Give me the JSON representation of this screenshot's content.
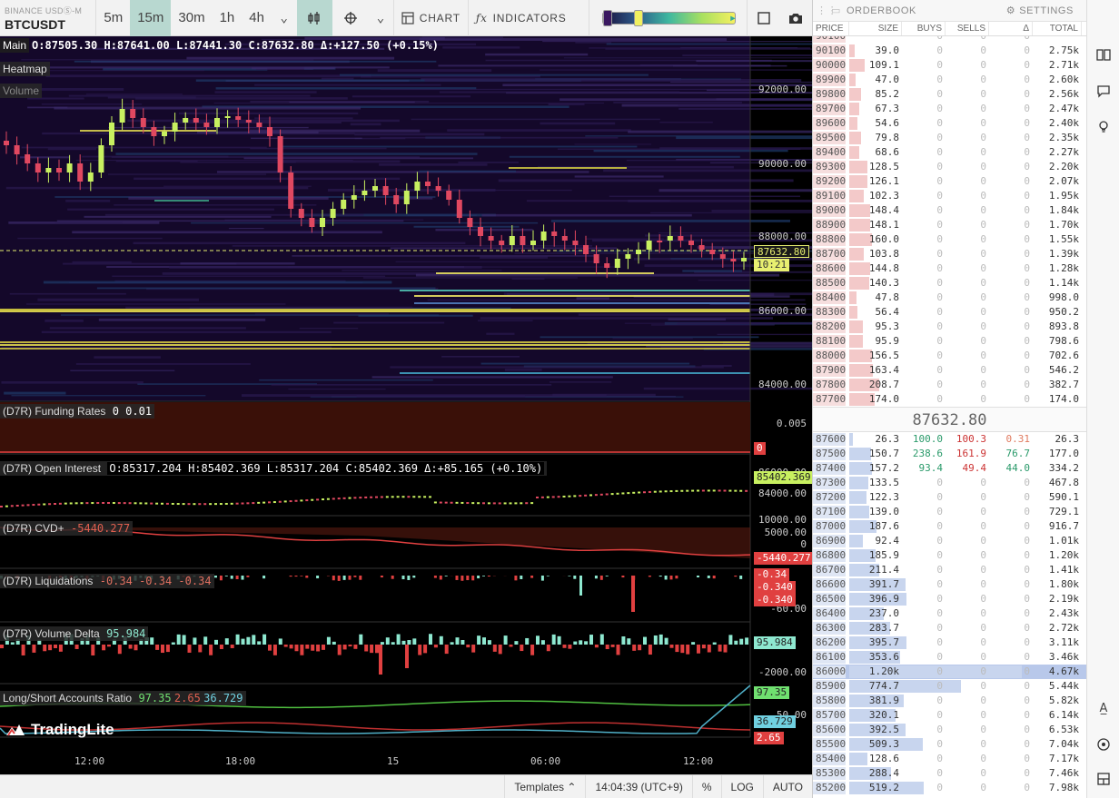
{
  "toolbar": {
    "exchange": "BINANCE USDⓈ-M",
    "symbol": "BTCUSDT",
    "timeframes": [
      "5m",
      "15m",
      "30m",
      "1h",
      "4h"
    ],
    "active_timeframe": "15m",
    "chart_label": "CHART",
    "indicators_label": "INDICATORS"
  },
  "main_pane": {
    "label": "Main",
    "ohlc": "O:87505.30 H:87641.00 L:87441.30 C:87632.80 Δ:+127.50 (+0.15%)",
    "overlays": [
      "Heatmap",
      "Volume"
    ],
    "price_axis": [
      "92000.00",
      "90000.00",
      "88000.00",
      "86000.00",
      "84000.00"
    ],
    "last_price": "87632.80",
    "countdown": "10:21"
  },
  "panes": [
    {
      "label": "(D7R) Funding Rates",
      "values": "0 0.01",
      "axis": [
        "0.005"
      ],
      "tag": "0"
    },
    {
      "label": "(D7R) Open Interest",
      "values": "O:85317.204 H:85402.369 L:85317.204 C:85402.369 Δ:+85.165 (+0.10%)",
      "axis": [
        "86000.00",
        "84000.00"
      ],
      "tag": "85402.369"
    },
    {
      "label": "(D7R) CVD+",
      "values": "-5440.277",
      "axis": [
        "10000.00",
        "5000.00",
        "0"
      ],
      "tag": "-5440.277"
    },
    {
      "label": "(D7R) Liquidations",
      "values": "-0.34 -0.34 -0.34",
      "axis": [
        "-60.00"
      ],
      "tags": [
        "-0.34",
        "-0.340",
        "-0.340"
      ]
    },
    {
      "label": "(D7R) Volume Delta",
      "values": "95.984",
      "axis": [
        "-2000.00"
      ],
      "tag": "95.984"
    },
    {
      "label": "Long/Short Accounts Ratio",
      "values": [
        "97.35",
        "2.65",
        "36.729"
      ],
      "axis": [
        "50.00"
      ],
      "tags": [
        "97.35",
        "36.729",
        "2.65"
      ]
    }
  ],
  "time_axis": [
    "12:00",
    "18:00",
    "15",
    "06:00",
    "12:00"
  ],
  "watermark": "TradingLite",
  "bottom_bar": {
    "templates": "Templates",
    "clock": "14:04:39 (UTC+9)",
    "percent": "%",
    "log": "LOG",
    "auto": "AUTO"
  },
  "orderbook": {
    "title": "ORDERBOOK",
    "settings": "SETTINGS",
    "columns": [
      "PRICE",
      "SIZE",
      "BUYS",
      "SELLS",
      "Δ",
      "TOTAL"
    ],
    "mid_price": "87632.80",
    "asks": [
      [
        "90100",
        "",
        "0",
        "0",
        "0",
        ""
      ],
      [
        "90100",
        "39.0",
        "0",
        "0",
        "0",
        "2.75k"
      ],
      [
        "90000",
        "109.1",
        "0",
        "0",
        "0",
        "2.71k"
      ],
      [
        "89900",
        "47.0",
        "0",
        "0",
        "0",
        "2.60k"
      ],
      [
        "89800",
        "85.2",
        "0",
        "0",
        "0",
        "2.56k"
      ],
      [
        "89700",
        "67.3",
        "0",
        "0",
        "0",
        "2.47k"
      ],
      [
        "89600",
        "54.6",
        "0",
        "0",
        "0",
        "2.40k"
      ],
      [
        "89500",
        "79.8",
        "0",
        "0",
        "0",
        "2.35k"
      ],
      [
        "89400",
        "68.6",
        "0",
        "0",
        "0",
        "2.27k"
      ],
      [
        "89300",
        "128.5",
        "0",
        "0",
        "0",
        "2.20k"
      ],
      [
        "89200",
        "126.1",
        "0",
        "0",
        "0",
        "2.07k"
      ],
      [
        "89100",
        "102.3",
        "0",
        "0",
        "0",
        "1.95k"
      ],
      [
        "89000",
        "148.4",
        "0",
        "0",
        "0",
        "1.84k"
      ],
      [
        "88900",
        "148.1",
        "0",
        "0",
        "0",
        "1.70k"
      ],
      [
        "88800",
        "160.0",
        "0",
        "0",
        "0",
        "1.55k"
      ],
      [
        "88700",
        "103.8",
        "0",
        "0",
        "0",
        "1.39k"
      ],
      [
        "88600",
        "144.8",
        "0",
        "0",
        "0",
        "1.28k"
      ],
      [
        "88500",
        "140.3",
        "0",
        "0",
        "0",
        "1.14k"
      ],
      [
        "88400",
        "47.8",
        "0",
        "0",
        "0",
        "998.0"
      ],
      [
        "88300",
        "56.4",
        "0",
        "0",
        "0",
        "950.2"
      ],
      [
        "88200",
        "95.3",
        "0",
        "0",
        "0",
        "893.8"
      ],
      [
        "88100",
        "95.9",
        "0",
        "0",
        "0",
        "798.6"
      ],
      [
        "88000",
        "156.5",
        "0",
        "0",
        "0",
        "702.6"
      ],
      [
        "87900",
        "163.4",
        "0",
        "0",
        "0",
        "546.2"
      ],
      [
        "87800",
        "208.7",
        "0",
        "0",
        "0",
        "382.7"
      ],
      [
        "87700",
        "174.0",
        "0",
        "0",
        "0",
        "174.0"
      ]
    ],
    "bids": [
      [
        "87600",
        "26.3",
        "100.0",
        "100.3",
        "0.31",
        "26.3"
      ],
      [
        "87500",
        "150.7",
        "238.6",
        "161.9",
        "76.7",
        "177.0"
      ],
      [
        "87400",
        "157.2",
        "93.4",
        "49.4",
        "44.0",
        "334.2"
      ],
      [
        "87300",
        "133.5",
        "0",
        "0",
        "0",
        "467.8"
      ],
      [
        "87200",
        "122.3",
        "0",
        "0",
        "0",
        "590.1"
      ],
      [
        "87100",
        "139.0",
        "0",
        "0",
        "0",
        "729.1"
      ],
      [
        "87000",
        "187.6",
        "0",
        "0",
        "0",
        "916.7"
      ],
      [
        "86900",
        "92.4",
        "0",
        "0",
        "0",
        "1.01k"
      ],
      [
        "86800",
        "185.9",
        "0",
        "0",
        "0",
        "1.20k"
      ],
      [
        "86700",
        "211.4",
        "0",
        "0",
        "0",
        "1.41k"
      ],
      [
        "86600",
        "391.7",
        "0",
        "0",
        "0",
        "1.80k"
      ],
      [
        "86500",
        "396.9",
        "0",
        "0",
        "0",
        "2.19k"
      ],
      [
        "86400",
        "237.0",
        "0",
        "0",
        "0",
        "2.43k"
      ],
      [
        "86300",
        "283.7",
        "0",
        "0",
        "0",
        "2.72k"
      ],
      [
        "86200",
        "395.7",
        "0",
        "0",
        "0",
        "3.11k"
      ],
      [
        "86100",
        "353.6",
        "0",
        "0",
        "0",
        "3.46k"
      ],
      [
        "86000",
        "1.20k",
        "0",
        "0",
        "0",
        "4.67k"
      ],
      [
        "85900",
        "774.7",
        "0",
        "0",
        "0",
        "5.44k"
      ],
      [
        "85800",
        "381.9",
        "0",
        "0",
        "0",
        "5.82k"
      ],
      [
        "85700",
        "320.1",
        "0",
        "0",
        "0",
        "6.14k"
      ],
      [
        "85600",
        "392.5",
        "0",
        "0",
        "0",
        "6.53k"
      ],
      [
        "85500",
        "509.3",
        "0",
        "0",
        "0",
        "7.04k"
      ],
      [
        "85400",
        "128.6",
        "0",
        "0",
        "0",
        "7.17k"
      ],
      [
        "85300",
        "288.4",
        "0",
        "0",
        "0",
        "7.46k"
      ],
      [
        "85200",
        "519.2",
        "0",
        "0",
        "0",
        "7.98k"
      ]
    ]
  },
  "colors": {
    "up": "#c8f060",
    "down": "#e04860",
    "accent": "#b8d8d0",
    "ask_bar": "#f3c9c9",
    "bid_bar": "#c8d5ee"
  }
}
